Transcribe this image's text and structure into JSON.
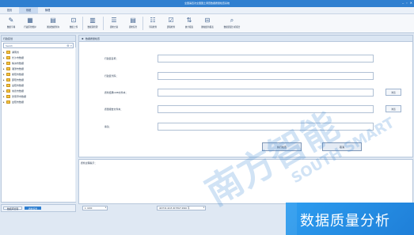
{
  "window": {
    "title": "全国第四次全国国土调查数据质量检查系统",
    "controls": [
      "–",
      "▫",
      "✕"
    ]
  },
  "menu": {
    "tabs": [
      "首页",
      "系统",
      "管理"
    ],
    "active_index": 1
  },
  "ribbon": {
    "buttons": [
      {
        "label": "数据字典",
        "icon": "dictionary-icon"
      },
      {
        "label": "行政区划维护",
        "icon": "region-icon"
      },
      {
        "label": "图斑数据查询",
        "icon": "parcel-query-icon"
      },
      {
        "label": "数据上传",
        "icon": "upload-icon"
      },
      {
        "label": "数据源管理",
        "icon": "datasource-icon"
      },
      {
        "label": "质检方案",
        "icon": "scheme-icon"
      },
      {
        "label": "质检任务",
        "icon": "task-icon"
      },
      {
        "label": "字段检查",
        "icon": "field-check-icon"
      },
      {
        "label": "逻辑检查",
        "icon": "logic-check-icon"
      },
      {
        "label": "统计报表",
        "icon": "report-icon"
      },
      {
        "label": "图幅更新报表",
        "icon": "sheet-report-icon"
      },
      {
        "label": "数据质量分析报告",
        "icon": "analysis-icon"
      }
    ]
  },
  "left_panel": {
    "header": "行政区划",
    "search_placeholder": "Search",
    "tree": [
      {
        "label": "湖南省"
      },
      {
        "label": "长沙市数据"
      },
      {
        "label": "株洲市数据"
      },
      {
        "label": "湘潭市数据"
      },
      {
        "label": "衡阳市数据"
      },
      {
        "label": "邵阳市数据"
      },
      {
        "label": "岳阳市数据"
      },
      {
        "label": "常德市数据"
      },
      {
        "label": "张家界市数据"
      },
      {
        "label": "益阳市数据"
      }
    ],
    "footer_buttons": [
      "数据库管理",
      "质检任务"
    ]
  },
  "main": {
    "header": "数据质量检查",
    "fields": [
      {
        "label": "行政区名称：",
        "value": ""
      },
      {
        "label": "行政区代码：",
        "value": ""
      },
      {
        "label": "质检结果GDB文件夹：",
        "value": ""
      },
      {
        "label": "质量报告文件夹：",
        "value": ""
      },
      {
        "label": "备注：",
        "value": ""
      }
    ],
    "browse_label": "浏览",
    "run_button": "执行检查",
    "cancel_button": "取消"
  },
  "result_panel": {
    "label": "质检过程提示："
  },
  "status": {
    "scale_value": "1: 1000",
    "coord_value": "403733.4415   3070527.9992   平"
  },
  "watermark": {
    "brand_cn": "南方智能",
    "brand_en": "SOUTH SMART"
  },
  "banner": {
    "text": "数据质量分析"
  },
  "colors": {
    "accent": "#2f7fd0",
    "banner": "#2c9df0",
    "folder": "#f4c542"
  }
}
